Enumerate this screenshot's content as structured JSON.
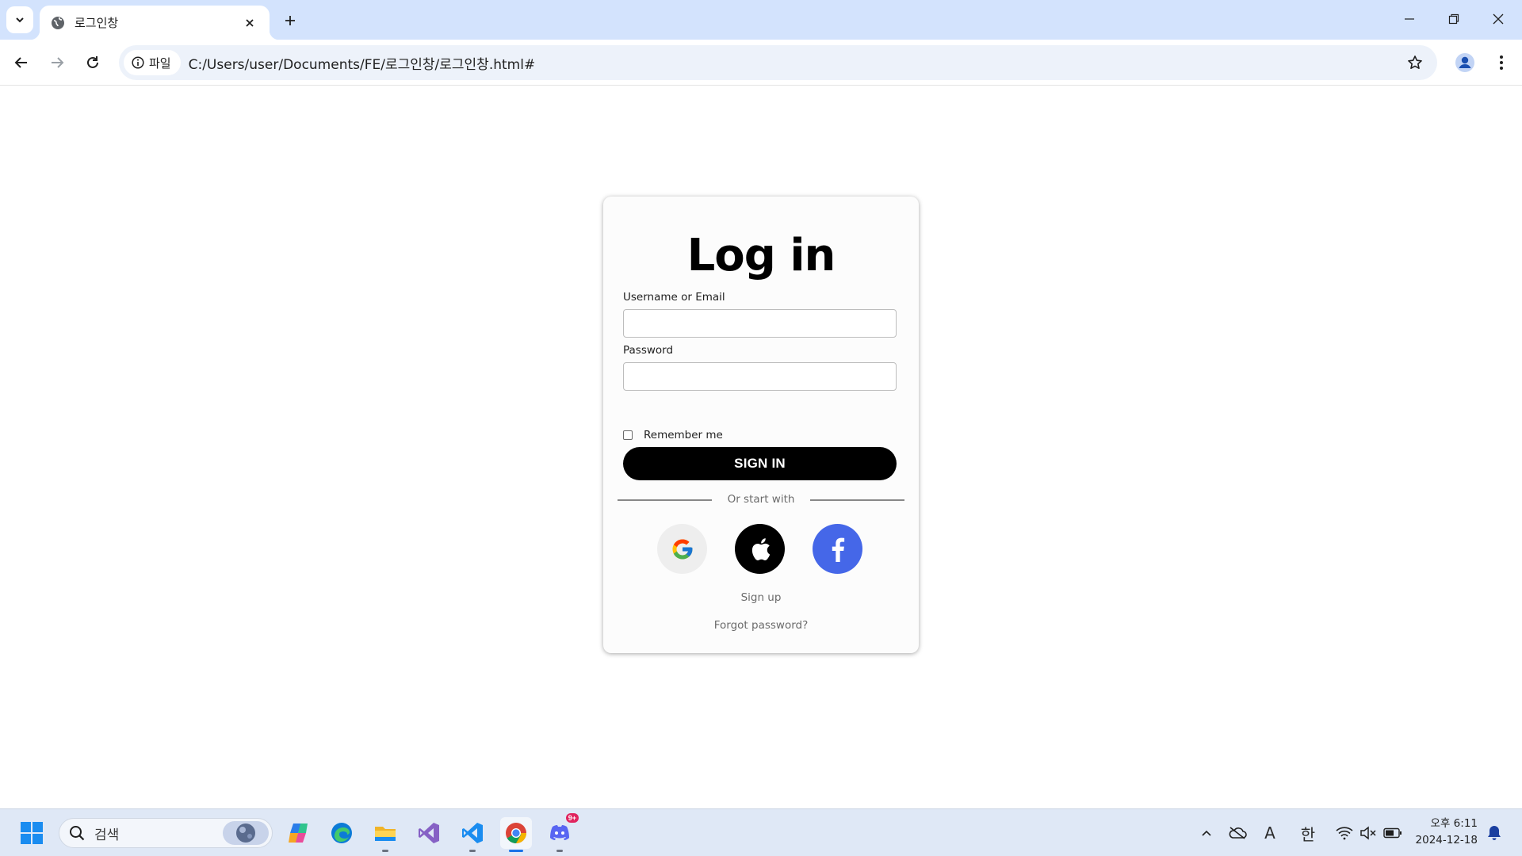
{
  "browser": {
    "tab": {
      "title": "로그인창"
    },
    "omnibox": {
      "chip_label": "파일",
      "url": "C:/Users/user/Documents/FE/로그인창/로그인창.html#"
    }
  },
  "login": {
    "heading": "Log in",
    "username_label": "Username or Email",
    "username_value": "",
    "password_label": "Password",
    "password_value": "",
    "remember_label": "Remember me",
    "remember_checked": false,
    "signin_label": "SIGN IN",
    "divider_text": "Or start with",
    "social": [
      {
        "name": "google",
        "icon": "google-icon",
        "color": "#eeeeee"
      },
      {
        "name": "apple",
        "icon": "apple-icon",
        "color": "#000000"
      },
      {
        "name": "facebook",
        "icon": "facebook-icon",
        "color": "#4567e8"
      }
    ],
    "signup_label": "Sign up",
    "forgot_label": "Forgot password?"
  },
  "taskbar": {
    "search_label": "검색",
    "apps": [
      "start-icon",
      "copilot-icon",
      "edge-icon",
      "file-explorer-icon",
      "visual-studio-icon",
      "vscode-icon",
      "chrome-icon",
      "discord-icon"
    ],
    "discord_badge": "9+",
    "tray": {
      "font_indicator": "A",
      "ime_label": "한"
    },
    "clock": {
      "time": "오후 6:11",
      "date": "2024-12-18"
    }
  }
}
